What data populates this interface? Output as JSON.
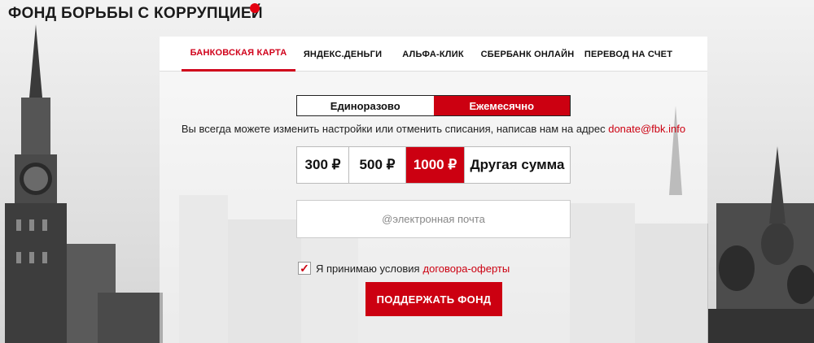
{
  "header": {
    "title": "ФОНД БОРЬБЫ С КОРРУПЦИЕЙ",
    "accent_color": "#e4000f"
  },
  "tabs": [
    {
      "label": "БАНКОВСКАЯ КАРТА",
      "active": true
    },
    {
      "label": "ЯНДЕКС.ДЕНЬГИ",
      "active": false
    },
    {
      "label": "АЛЬФА-КЛИК",
      "active": false
    },
    {
      "label": "СБЕРБАНК ОНЛАЙН",
      "active": false
    },
    {
      "label": "ПЕРЕВОД НА СЧЕТ",
      "active": false
    }
  ],
  "frequency": {
    "options": [
      "Единоразово",
      "Ежемесячно"
    ],
    "selected": "Ежемесячно"
  },
  "hint": {
    "text": "Вы всегда можете изменить настройки или отменить списания, написав нам на адрес",
    "email": "donate@fbk.info"
  },
  "amounts": {
    "options": [
      "300 ₽",
      "500 ₽",
      "1000 ₽",
      "Другая сумма"
    ],
    "selected": "1000 ₽"
  },
  "email_field": {
    "placeholder": "@электронная почта",
    "value": ""
  },
  "agreement": {
    "checked": true,
    "text": "Я принимаю условия",
    "link": "договора-оферты"
  },
  "submit": {
    "label": "ПОДДЕРЖАТЬ ФОНД"
  },
  "colors": {
    "brand_red": "#cc0011"
  }
}
